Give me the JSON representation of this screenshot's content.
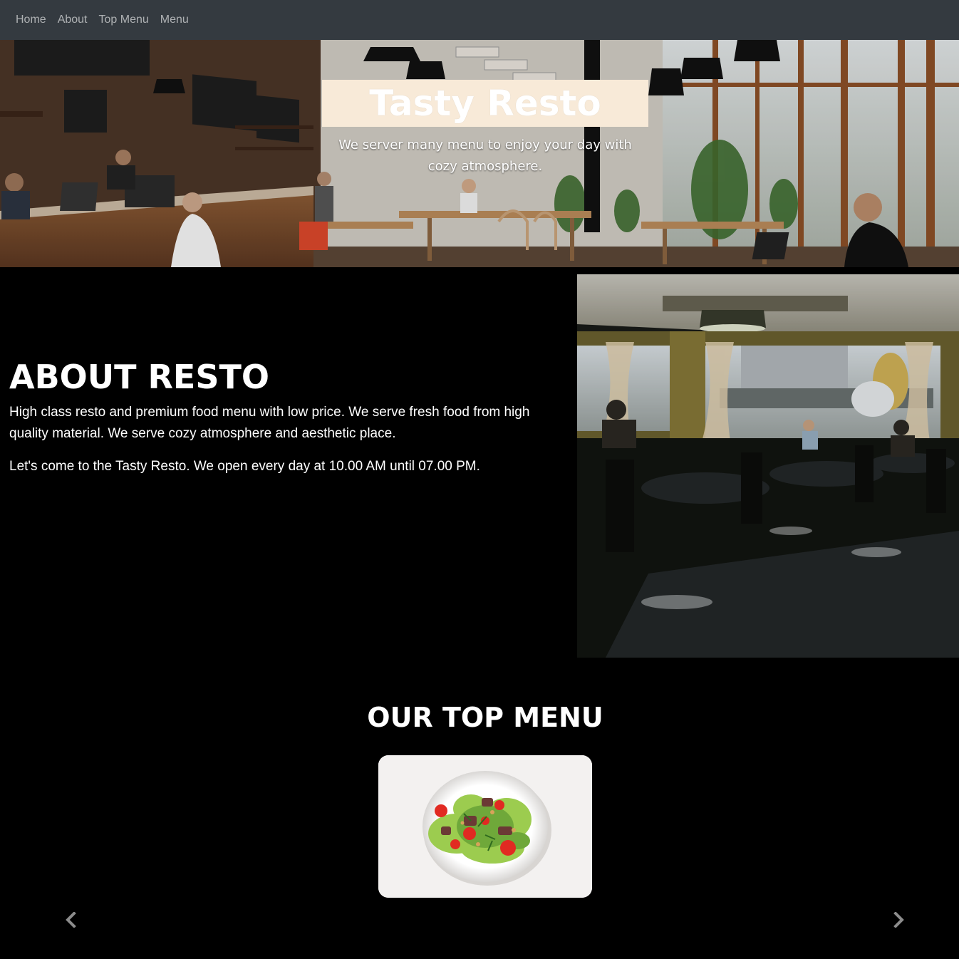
{
  "nav": {
    "items": [
      {
        "label": "Home"
      },
      {
        "label": "About"
      },
      {
        "label": "Top Menu"
      },
      {
        "label": "Menu"
      }
    ]
  },
  "hero": {
    "title": "Tasty Resto",
    "subtitle": "We server many menu to enjoy your day with cozy atmosphere."
  },
  "about": {
    "title": "ABOUT RESTO",
    "paragraphs": [
      "High class resto and premium food menu with low price. We serve fresh food from high quality material. We serve cozy atmosphere and aesthetic place.",
      "Let's come to the Tasty Resto. We open every day at 10.00 AM until 07.00 PM."
    ]
  },
  "top_menu": {
    "title": "OUR TOP MENU"
  },
  "carousel": {
    "prev_icon": "chevron-left-icon",
    "next_icon": "chevron-right-icon"
  },
  "colors": {
    "navbar_bg": "#343a40",
    "title_box_bg": "#f8ead8",
    "page_bg": "#000000"
  }
}
